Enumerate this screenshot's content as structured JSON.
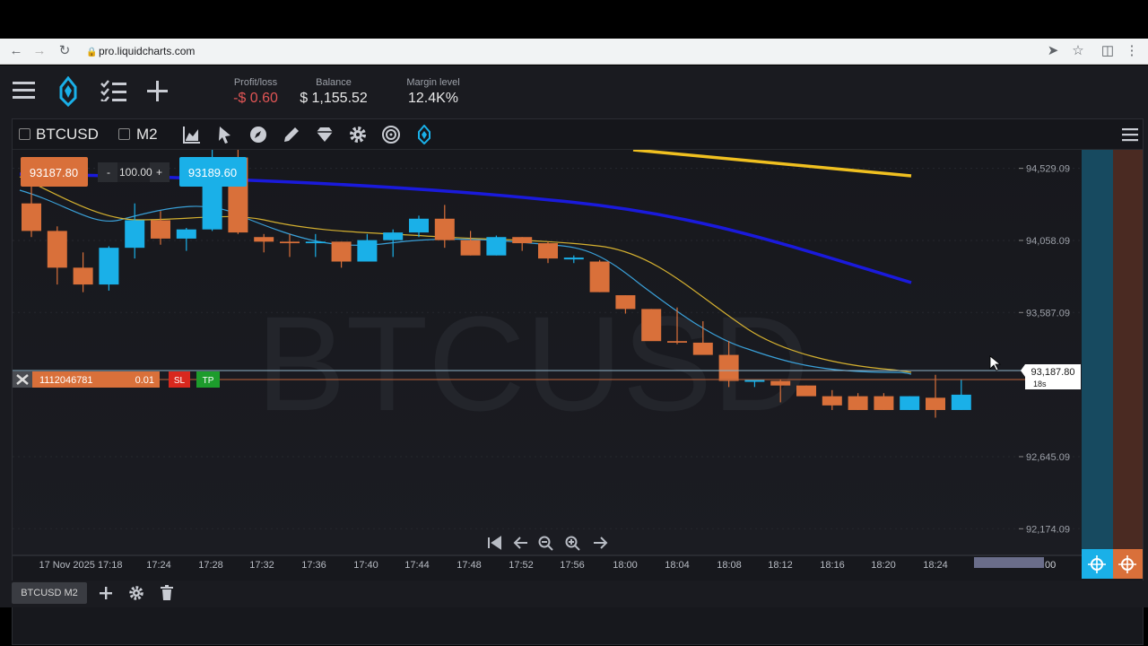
{
  "browser": {
    "url": "pro.liquidcharts.com"
  },
  "account": {
    "profit_loss_label": "Profit/loss",
    "profit_loss_value": "-$ 0.60",
    "balance_label": "Balance",
    "balance_value": "$ 1,155.52",
    "margin_label": "Margin level",
    "margin_value": "12.4K%"
  },
  "toolbar": {
    "symbol": "BTCUSD",
    "timeframe": "M2"
  },
  "order_panel": {
    "sell_price": "93187.80",
    "quantity": "100.00",
    "minus": "-",
    "plus": "+",
    "buy_price": "93189.60"
  },
  "position": {
    "id": "1112046781",
    "volume": "0.01",
    "sl_label": "SL",
    "tp_label": "TP"
  },
  "watermark": "BTCUSD",
  "price_axis": {
    "labels": [
      "94,529.09",
      "94,058.09",
      "93,587.09",
      "92,645.09",
      "92,174.09"
    ],
    "current_price": "93,187.80",
    "countdown": "18s"
  },
  "time_axis": {
    "labels": [
      "17 Nov 2025 17:18",
      "17:24",
      "17:28",
      "17:32",
      "17:36",
      "17:40",
      "17:44",
      "17:48",
      "17:52",
      "17:56",
      "18:00",
      "18:04",
      "18:08",
      "18:12",
      "18:16",
      "18:20",
      "18:24"
    ],
    "end_label": "00"
  },
  "footer": {
    "tab_label": "BTCUSD M2"
  },
  "colors": {
    "bull": "#1ab0e8",
    "bear": "#d9703a",
    "ma_fast": "#3aa0d8",
    "ma_mid": "#d4b030",
    "ma_blue": "#1a1adc",
    "ma_yellow": "#f0c020"
  },
  "chart_data": {
    "type": "candlestick",
    "series": [
      {
        "name": "",
        "ohlc": [
          [
            94300,
            94420,
            94080,
            94120
          ],
          [
            94120,
            94150,
            93770,
            93880
          ],
          [
            93880,
            93980,
            93720,
            93770
          ],
          [
            93770,
            94020,
            93730,
            94010
          ],
          [
            94010,
            94300,
            93940,
            94190
          ],
          [
            94190,
            94250,
            94030,
            94070
          ],
          [
            94070,
            94140,
            93990,
            94130
          ],
          [
            94130,
            94660,
            94120,
            94600
          ],
          [
            94600,
            94660,
            94100,
            94110
          ],
          [
            94080,
            94100,
            93980,
            94050
          ],
          [
            94050,
            94100,
            93950,
            94040
          ],
          [
            94040,
            94100,
            93950,
            94050
          ],
          [
            94050,
            94050,
            93880,
            93920
          ],
          [
            93920,
            94100,
            93920,
            94060
          ],
          [
            94060,
            94130,
            93950,
            94110
          ],
          [
            94110,
            94220,
            94080,
            94200
          ],
          [
            94200,
            94290,
            94010,
            94060
          ],
          [
            94060,
            94120,
            93960,
            93960
          ],
          [
            93960,
            94090,
            93960,
            94080
          ],
          [
            94080,
            94080,
            93990,
            94040
          ],
          [
            94040,
            94050,
            93910,
            93940
          ],
          [
            93940,
            93960,
            93910,
            93940
          ],
          [
            93920,
            93930,
            93720,
            93720
          ],
          [
            93700,
            93700,
            93580,
            93610
          ],
          [
            93610,
            93610,
            93410,
            93400
          ],
          [
            93400,
            93620,
            93380,
            93390
          ],
          [
            93390,
            93530,
            93370,
            93310
          ],
          [
            93310,
            93400,
            93100,
            93140
          ],
          [
            93140,
            93140,
            93100,
            93140
          ],
          [
            93140,
            93150,
            93000,
            93110
          ],
          [
            93110,
            93110,
            93060,
            93040
          ],
          [
            93040,
            93080,
            92950,
            92980
          ],
          [
            93040,
            93060,
            92950,
            92950
          ],
          [
            93040,
            93060,
            92950,
            92950
          ],
          [
            92950,
            93040,
            92950,
            93040
          ],
          [
            93030,
            93180,
            92900,
            92950
          ],
          [
            92950,
            93150,
            92950,
            93050
          ]
        ]
      }
    ],
    "xlabels_note": "",
    "ylim": [
      92000,
      94650
    ]
  }
}
